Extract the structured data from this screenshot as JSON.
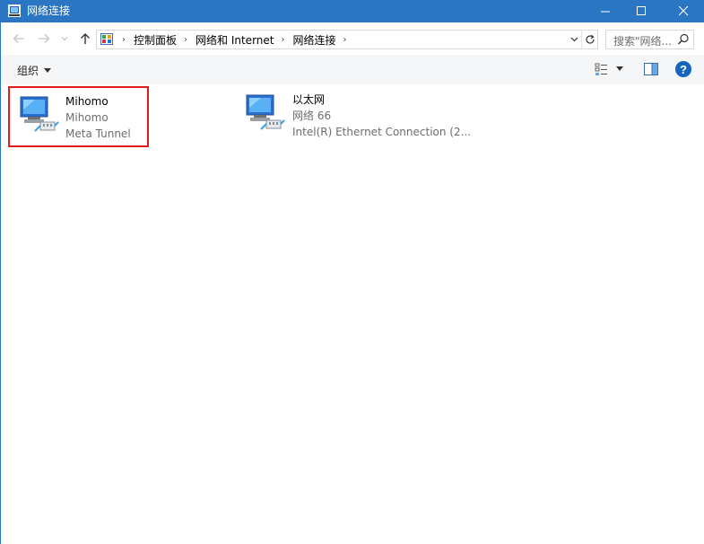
{
  "window": {
    "title": "网络连接",
    "colors": {
      "titlebar": "#2b76c2",
      "selection_border": "#e41b1b",
      "help": "#1565c0"
    }
  },
  "address_bar": {
    "breadcrumbs": [
      "控制面板",
      "网络和 Internet",
      "网络连接"
    ]
  },
  "search": {
    "placeholder": "搜索\"网络..."
  },
  "toolbar": {
    "organize_label": "组织"
  },
  "connections": [
    {
      "name": "Mihomo",
      "network": "Mihomo",
      "adapter": "Meta Tunnel",
      "selected": true
    },
    {
      "name": "以太网",
      "network": "网络 66",
      "adapter": "Intel(R) Ethernet Connection (2..."
    }
  ],
  "icons": {
    "app": "network-connections-icon",
    "back": "back-arrow-icon",
    "forward": "forward-arrow-icon",
    "recent": "chevron-down-icon",
    "up": "up-arrow-icon",
    "control_panel": "control-panel-icon",
    "refresh": "refresh-icon",
    "search": "search-icon",
    "view": "change-view-icon",
    "preview_pane": "preview-pane-icon",
    "help": "help-icon",
    "network_adapter": "network-adapter-icon"
  }
}
